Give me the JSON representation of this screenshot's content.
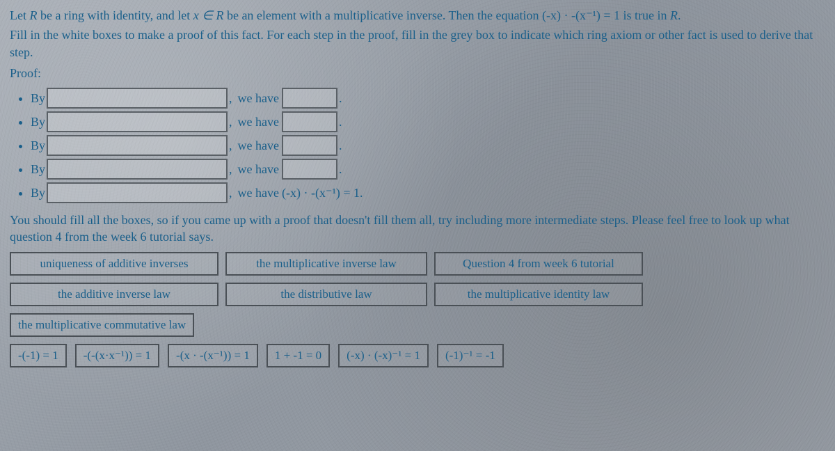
{
  "intro": {
    "line1_a": "Let ",
    "line1_b": " be a ring with identity, and let ",
    "line1_c": " be an element with a multiplicative inverse.  Then the equation ",
    "line1_eq": "(-x) · -(x⁻¹) = 1",
    "line1_d": " is true in ",
    "line1_e": ".",
    "R": "R",
    "x_in_R": "x ∈ R",
    "line2": "Fill in the white boxes to make a proof of this fact.  For each step in the proof, fill in the grey box to indicate which ring axiom or other fact is used to derive that step."
  },
  "proof_label": "Proof:",
  "steps": [
    {
      "by": "By",
      "we_have": "we have",
      "final": ""
    },
    {
      "by": "By",
      "we_have": "we have",
      "final": ""
    },
    {
      "by": "By",
      "we_have": "we have",
      "final": ""
    },
    {
      "by": "By",
      "we_have": "we have",
      "final": ""
    },
    {
      "by": "By",
      "we_have": "we have",
      "final": "(-x) · -(x⁻¹) = 1."
    }
  ],
  "note": {
    "line1": "You should fill all the boxes, so if you came up with a proof that doesn't fill them all, try including more intermediate steps.  Please feel free to look up what question 4 from the week 6 tutorial says."
  },
  "choices_text": {
    "row1": [
      "uniqueness of additive inverses",
      "the multiplicative inverse law",
      "Question 4 from week 6 tutorial"
    ],
    "row2": [
      "the additive inverse law",
      "the distributive law",
      "the multiplicative identity law"
    ],
    "row3": [
      "the multiplicative commutative law"
    ]
  },
  "choices_math": [
    "-(-1) = 1",
    "-(-(x·x⁻¹)) = 1",
    "-(x · -(x⁻¹)) = 1",
    "1 + -1 = 0",
    "(-x) · (-x)⁻¹ = 1",
    "(-1)⁻¹ = -1"
  ]
}
